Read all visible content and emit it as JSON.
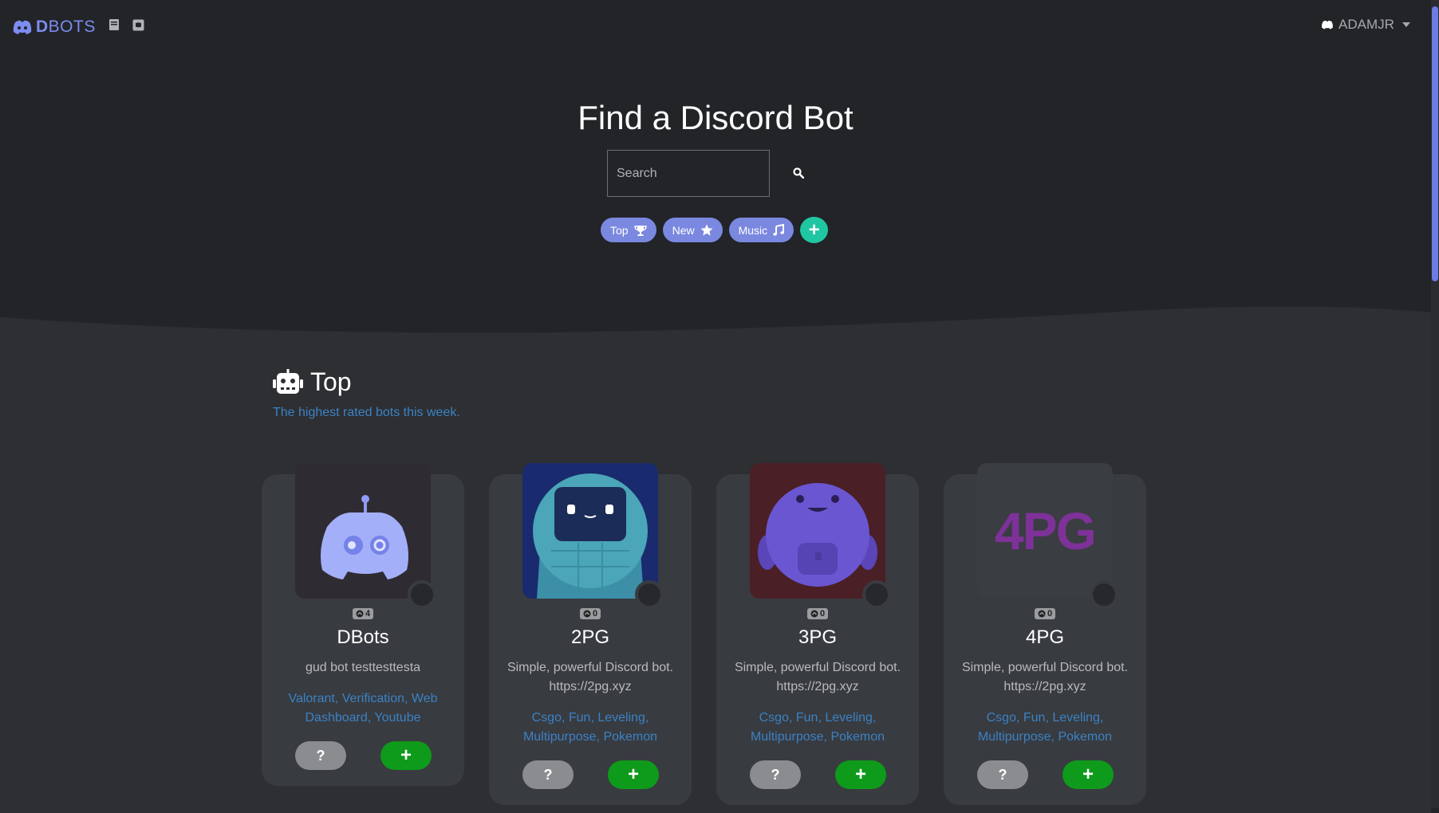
{
  "nav": {
    "brand_bold": "D",
    "brand_rest": "BOTS",
    "user_name": "ADAMJR"
  },
  "hero": {
    "title": "Find a Discord Bot",
    "search_placeholder": "Search",
    "pills": [
      {
        "label": "Top",
        "icon": "trophy-icon"
      },
      {
        "label": "New",
        "icon": "star-icon"
      },
      {
        "label": "Music",
        "icon": "music-note-icon"
      }
    ],
    "add_label": "+"
  },
  "section": {
    "title": "Top",
    "subtitle": "The highest rated bots this week."
  },
  "cards": [
    {
      "name": "DBots",
      "votes": "4",
      "desc": "gud bot testtesttesta",
      "tags": "Valorant, Verification, Web Dashboard, Youtube",
      "info_label": "?",
      "add_label": "+"
    },
    {
      "name": "2PG",
      "votes": "0",
      "desc": "Simple, powerful Discord bot. https://2pg.xyz",
      "tags": "Csgo, Fun, Leveling, Multipurpose, Pokemon",
      "info_label": "?",
      "add_label": "+"
    },
    {
      "name": "3PG",
      "votes": "0",
      "desc": "Simple, powerful Discord bot. https://2pg.xyz",
      "tags": "Csgo, Fun, Leveling, Multipurpose, Pokemon",
      "info_label": "?",
      "add_label": "+"
    },
    {
      "name": "4PG",
      "votes": "0",
      "desc": "Simple, powerful Discord bot. https://2pg.xyz",
      "tags": "Csgo, Fun, Leveling, Multipurpose, Pokemon",
      "info_label": "?",
      "add_label": "+",
      "logo_text": "4PG"
    }
  ],
  "colors": {
    "accent": "#7a88e0",
    "add_teal": "#20c6a2",
    "add_green": "#0e9a1a",
    "link_blue": "#3b82c4"
  }
}
